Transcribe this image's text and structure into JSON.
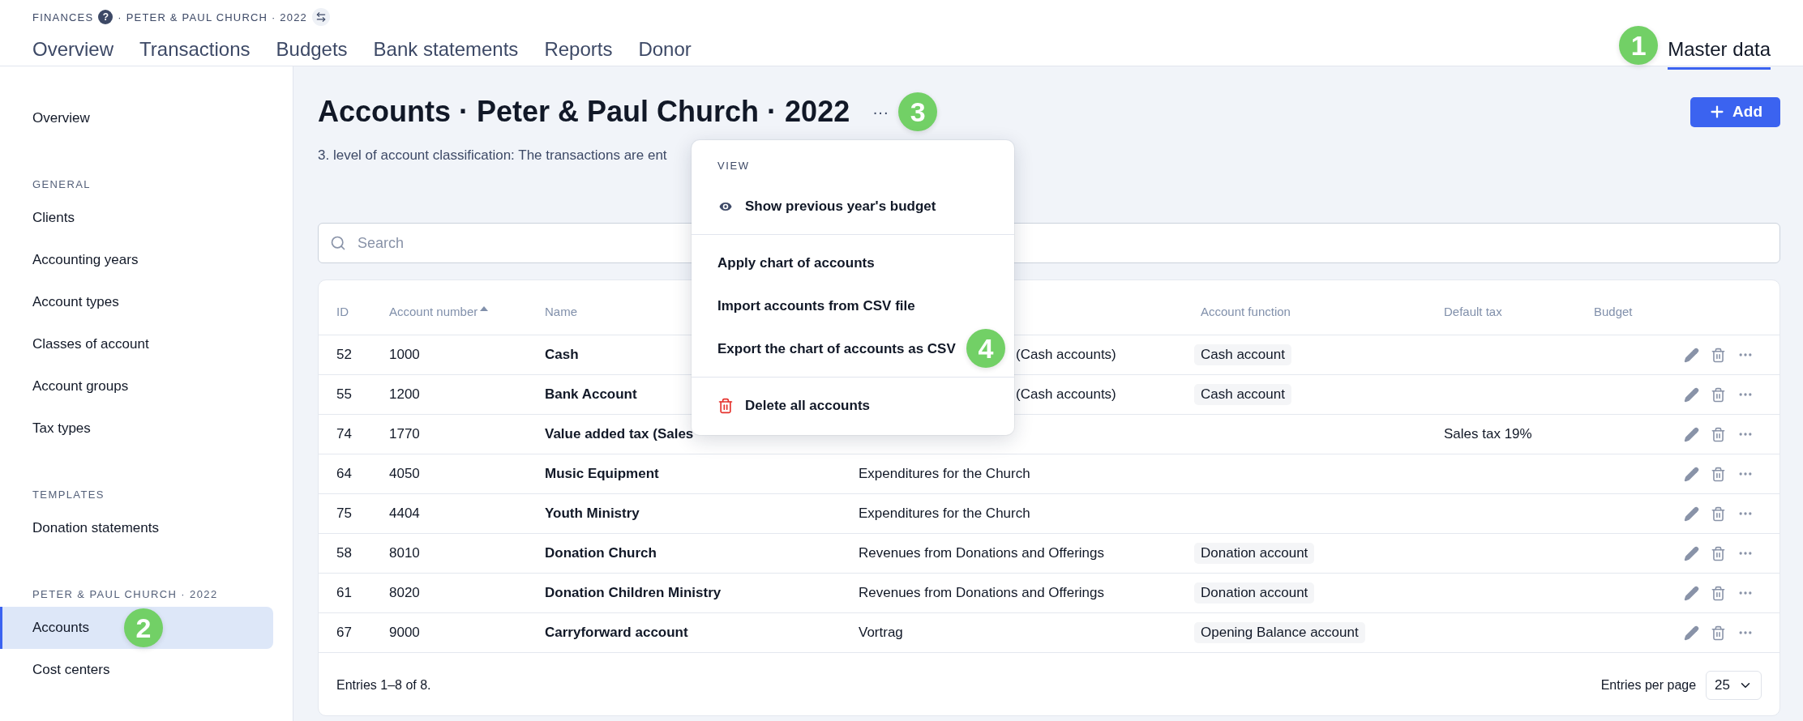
{
  "breadcrumb": {
    "section": "FINANCES",
    "help": "?",
    "context": "· PETER & PAUL CHURCH · 2022"
  },
  "tabs": [
    {
      "label": "Overview",
      "selected": false
    },
    {
      "label": "Transactions",
      "selected": false
    },
    {
      "label": "Budgets",
      "selected": false
    },
    {
      "label": "Bank statements",
      "selected": false
    },
    {
      "label": "Reports",
      "selected": false
    },
    {
      "label": "Donor",
      "selected": false
    },
    {
      "label": "Master data",
      "selected": true
    }
  ],
  "sidebar": {
    "items": [
      {
        "kind": "item",
        "label": "Overview",
        "selected": false
      },
      {
        "kind": "heading",
        "label": "GENERAL"
      },
      {
        "kind": "item",
        "label": "Clients",
        "selected": false
      },
      {
        "kind": "item",
        "label": "Accounting years",
        "selected": false
      },
      {
        "kind": "item",
        "label": "Account types",
        "selected": false
      },
      {
        "kind": "item",
        "label": "Classes of account",
        "selected": false
      },
      {
        "kind": "item",
        "label": "Account groups",
        "selected": false
      },
      {
        "kind": "item",
        "label": "Tax types",
        "selected": false
      },
      {
        "kind": "heading",
        "label": "TEMPLATES"
      },
      {
        "kind": "item",
        "label": "Donation statements",
        "selected": false
      },
      {
        "kind": "heading",
        "label": "PETER & PAUL CHURCH · 2022"
      },
      {
        "kind": "item",
        "label": "Accounts",
        "selected": true
      },
      {
        "kind": "item",
        "label": "Cost centers",
        "selected": false
      }
    ]
  },
  "page": {
    "title": "Accounts · Peter & Paul Church · 2022",
    "more": "···",
    "description": "3. level of account classification: The transactions are ent",
    "add_button": "Add"
  },
  "menu": {
    "items": [
      {
        "kind": "heading",
        "label": "VIEW"
      },
      {
        "kind": "icon-item",
        "label": "Show previous year's budget"
      },
      {
        "kind": "divider"
      },
      {
        "kind": "item",
        "label": "Apply chart of accounts"
      },
      {
        "kind": "item",
        "label": "Import accounts from CSV file"
      },
      {
        "kind": "item",
        "label": "Export the chart of accounts as CSV"
      },
      {
        "kind": "divider"
      },
      {
        "kind": "danger-item",
        "label": "Delete all accounts"
      }
    ]
  },
  "search": {
    "placeholder": "Search"
  },
  "table": {
    "columns": [
      {
        "label": "ID"
      },
      {
        "label": "Account number",
        "sorted_ascending": true
      },
      {
        "label": "Name"
      },
      {},
      {
        "label": "Account function"
      },
      {
        "label": "Default tax"
      },
      {
        "label": "Budget"
      }
    ],
    "rows": [
      {
        "id": "52",
        "number": "1000",
        "name": "Cash",
        "column_4": "(Cash accounts)",
        "column_4_partial": true,
        "account_function": "Cash account"
      },
      {
        "id": "55",
        "number": "1200",
        "name": "Bank Account",
        "column_4": "(Cash accounts)",
        "column_4_partial": true,
        "account_function": "Cash account"
      },
      {
        "id": "74",
        "number": "1770",
        "name": "Value added tax (Sales",
        "default_tax": "Sales tax 19%"
      },
      {
        "id": "64",
        "number": "4050",
        "name": "Music Equipment",
        "column_4": "Expenditures for the Church"
      },
      {
        "id": "75",
        "number": "4404",
        "name": "Youth Ministry",
        "column_4": "Expenditures for the Church"
      },
      {
        "id": "58",
        "number": "8010",
        "name": "Donation Church",
        "column_4": "Revenues from Donations and Offerings",
        "account_function": "Donation account"
      },
      {
        "id": "61",
        "number": "8020",
        "name": "Donation Children Ministry",
        "column_4": "Revenues from Donations and Offerings",
        "account_function": "Donation account"
      },
      {
        "id": "67",
        "number": "9000",
        "name": "Carryforward account",
        "column_4": "Vortrag",
        "account_function": "Opening Balance account"
      }
    ],
    "entries": "Entries 1–8 of 8.",
    "per_page_label": "Entries per page",
    "per_page": "25"
  },
  "callouts": [
    {
      "label": "1"
    },
    {
      "label": "2"
    },
    {
      "label": "3"
    },
    {
      "label": "4"
    }
  ]
}
